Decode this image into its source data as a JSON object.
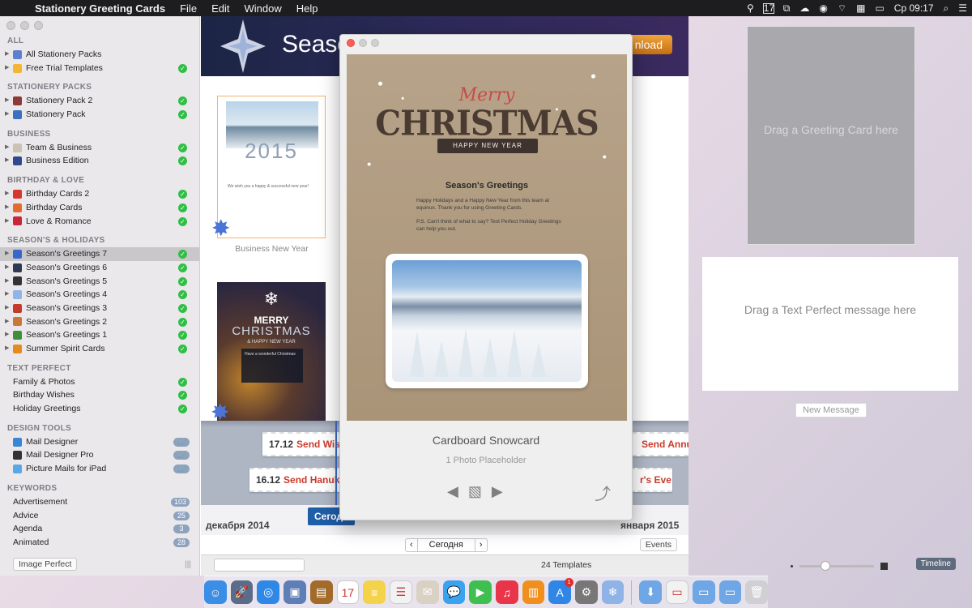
{
  "menubar": {
    "app_name": "Stationery Greeting Cards",
    "menus": [
      "File",
      "Edit",
      "Window",
      "Help"
    ],
    "calendar_day": "17",
    "clock": "Ср 09:17"
  },
  "sidebar": {
    "sections": [
      {
        "title": "ALL",
        "items": [
          {
            "label": "All Stationery Packs",
            "icon_color": "#5c7fd1",
            "check": false,
            "tri": true
          },
          {
            "label": "Free Trial Templates",
            "icon_color": "#f3b533",
            "check": true,
            "tri": true
          }
        ]
      },
      {
        "title": "STATIONERY PACKS",
        "items": [
          {
            "label": "Stationery Pack 2",
            "icon_color": "#8b3a3a",
            "check": true,
            "tri": true
          },
          {
            "label": "Stationery Pack",
            "icon_color": "#3a6fc1",
            "check": true,
            "tri": true
          }
        ]
      },
      {
        "title": "BUSINESS",
        "items": [
          {
            "label": "Team & Business",
            "icon_color": "#c9c3b5",
            "check": true,
            "tri": true
          },
          {
            "label": "Business Edition",
            "icon_color": "#2f4a8c",
            "check": true,
            "tri": true
          }
        ]
      },
      {
        "title": "BIRTHDAY & LOVE",
        "items": [
          {
            "label": "Birthday Cards 2",
            "icon_color": "#d6362d",
            "check": true,
            "tri": true
          },
          {
            "label": "Birthday Cards",
            "icon_color": "#e36b2f",
            "check": true,
            "tri": true
          },
          {
            "label": "Love & Romance",
            "icon_color": "#c8263b",
            "check": true,
            "tri": true
          }
        ]
      },
      {
        "title": "SEASON'S & HOLIDAYS",
        "items": [
          {
            "label": "Season's Greetings 7",
            "icon_color": "#3b66c9",
            "check": true,
            "tri": true,
            "selected": true
          },
          {
            "label": "Season's Greetings 6",
            "icon_color": "#2f3a52",
            "check": true,
            "tri": true
          },
          {
            "label": "Season's Greetings 5",
            "icon_color": "#333333",
            "check": true,
            "tri": true
          },
          {
            "label": "Season's Greetings 4",
            "icon_color": "#8fb5e6",
            "check": true,
            "tri": true
          },
          {
            "label": "Season's Greetings 3",
            "icon_color": "#c53b2b",
            "check": true,
            "tri": true
          },
          {
            "label": "Season's Greetings 2",
            "icon_color": "#c9773a",
            "check": true,
            "tri": true
          },
          {
            "label": "Season's Greetings 1",
            "icon_color": "#3f8f3a",
            "check": true,
            "tri": true
          },
          {
            "label": "Summer Spirit Cards",
            "icon_color": "#e58a1f",
            "check": true,
            "tri": true
          }
        ]
      },
      {
        "title": "TEXT PERFECT",
        "items": [
          {
            "label": "Family & Photos",
            "check": true
          },
          {
            "label": "Birthday Wishes",
            "check": true
          },
          {
            "label": "Holiday Greetings",
            "check": true
          }
        ]
      },
      {
        "title": "DESIGN TOOLS",
        "items": [
          {
            "label": "Mail Designer",
            "icon_color": "#3a86d4",
            "cart": true
          },
          {
            "label": "Mail Designer Pro",
            "icon_color": "#333333",
            "cart": true
          },
          {
            "label": "Picture Mails for iPad",
            "icon_color": "#5aa7e6",
            "cart": true
          }
        ]
      },
      {
        "title": "KEYWORDS",
        "items": [
          {
            "label": "Advertisement",
            "badge": "103"
          },
          {
            "label": "Advice",
            "badge": "25"
          },
          {
            "label": "Agenda",
            "badge": "3"
          },
          {
            "label": "Animated",
            "badge": "28"
          }
        ]
      }
    ],
    "bottom_button": "Image Perfect",
    "grip": "|||"
  },
  "banner": {
    "title": "Seaso",
    "download": "nload"
  },
  "templates": {
    "thumb1": {
      "year": "2015",
      "text": "We wish you a happy & successful new year!",
      "label": "Business New Year"
    },
    "thumb2": {
      "line1": "MERRY",
      "line2": "CHRISTMAS",
      "line3": "& HAPPY NEW YEAR",
      "box": "Have a wonderful Christmas"
    }
  },
  "timeline": {
    "events": [
      {
        "date": "17.12",
        "title": "Send Wis"
      },
      {
        "date": "16.12",
        "title": "Send Hanuk"
      },
      {
        "date": "",
        "title": "Send Annua"
      },
      {
        "date": "",
        "title": "r's Eve"
      }
    ],
    "month_left": "декабря 2014",
    "month_right": "января 2015",
    "today": "Сегодн",
    "nav_prev": "‹",
    "nav_today": "Сегодня",
    "nav_next": "›",
    "events_button": "Events",
    "count": "24 Templates"
  },
  "preview": {
    "merry": "Merry",
    "christmas": "CHRISTMAS",
    "ribbon": "HAPPY NEW YEAR",
    "greeting_title": "Season's Greetings",
    "body1": "Happy Holidays and a Happy New Year from this team at equinux. Thank you for using Greeting Cards.",
    "body2": "P.S. Can't think of what to say? Text Perfect Holiday Greetings can help you out.",
    "name": "Cardboard Snowcard",
    "sub": "1 Photo Placeholder"
  },
  "right_panel": {
    "drop_greeting": "Drag a Greeting Card here",
    "drop_text": "Drag a Text Perfect message here",
    "new_message": "New Message",
    "timeline_button": "Timeline"
  },
  "dock": {
    "items": [
      {
        "name": "finder",
        "color": "#3a8ee6",
        "glyph": "☺"
      },
      {
        "name": "launchpad",
        "color": "#5a6c8a",
        "glyph": "🚀"
      },
      {
        "name": "safari",
        "color": "#2f87e6",
        "glyph": "◎"
      },
      {
        "name": "preview",
        "color": "#5e7eb6",
        "glyph": "▣"
      },
      {
        "name": "notes-book",
        "color": "#a26b2a",
        "glyph": "▤"
      },
      {
        "name": "calendar",
        "color": "#ffffff",
        "glyph": "17"
      },
      {
        "name": "notes",
        "color": "#f4d34a",
        "glyph": "≡"
      },
      {
        "name": "reminders",
        "color": "#f2f2f2",
        "glyph": "☰"
      },
      {
        "name": "stationery",
        "color": "#d9d2c4",
        "glyph": "✉"
      },
      {
        "name": "messages",
        "color": "#3aa3f0",
        "glyph": "💬"
      },
      {
        "name": "facetime",
        "color": "#3fbf4f",
        "glyph": "▶"
      },
      {
        "name": "itunes",
        "color": "#e8354a",
        "glyph": "♫"
      },
      {
        "name": "ibooks",
        "color": "#f08f1d",
        "glyph": "▥"
      },
      {
        "name": "appstore",
        "color": "#2f86e6",
        "glyph": "A",
        "notif": "1"
      },
      {
        "name": "system-preferences",
        "color": "#777777",
        "glyph": "⚙"
      },
      {
        "name": "greeting-cards",
        "color": "#8fb3e6",
        "glyph": "❄"
      },
      {
        "name": "sep"
      },
      {
        "name": "downloads",
        "color": "#6fa7e6",
        "glyph": "⬇"
      },
      {
        "name": "documents",
        "color": "#f2f2f2",
        "glyph": "▭"
      },
      {
        "name": "folder",
        "color": "#6fa7e6",
        "glyph": "▭"
      },
      {
        "name": "folder2",
        "color": "#6fa7e6",
        "glyph": "▭"
      },
      {
        "name": "trash",
        "color": "#cfcfd4",
        "glyph": "🗑"
      }
    ]
  }
}
